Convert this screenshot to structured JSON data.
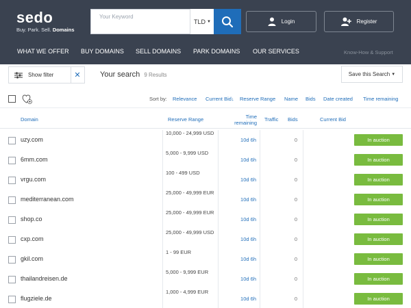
{
  "brand": {
    "name": "sedo",
    "tagline": "Buy. Park. Sell.",
    "tagline_strong": "Domains"
  },
  "search": {
    "placeholder": "Your Keyword",
    "tld_label": "TLD"
  },
  "header_buttons": {
    "login": "Login",
    "register": "Register"
  },
  "nav": {
    "items": [
      "WHAT WE OFFER",
      "BUY DOMAINS",
      "SELL DOMAINS",
      "PARK DOMAINS",
      "OUR SERVICES"
    ],
    "secondary": "Know-How & Support"
  },
  "toolbar": {
    "show_filter": "Show filter",
    "your_search": "Your search",
    "results": "9 Results",
    "save_search": "Save this Search"
  },
  "sort": {
    "label": "Sort by:",
    "options": [
      "Relevance",
      "Current Bid↓",
      "Reserve Range",
      "Name",
      "Bids",
      "Date created",
      "Time remaining"
    ]
  },
  "table": {
    "headers": {
      "domain": "Domain",
      "reserve_range": "Reserve Range",
      "time_remaining_1": "Time",
      "time_remaining_2": "remaining",
      "traffic": "Traffic",
      "bids": "Bids",
      "current_bid": "Current Bid"
    },
    "rows": [
      {
        "domain": "uzy.com",
        "range": "10,000 - 24,999 USD",
        "time": "10d 6h",
        "bids": "0",
        "status": "In auction"
      },
      {
        "domain": "6mm.com",
        "range": "5,000 - 9,999 USD",
        "time": "10d 6h",
        "bids": "0",
        "status": "In auction"
      },
      {
        "domain": "vrgu.com",
        "range": "100 - 499 USD",
        "time": "10d 6h",
        "bids": "0",
        "status": "In auction"
      },
      {
        "domain": "mediterranean.com",
        "range": "25,000 - 49,999 EUR",
        "time": "10d 6h",
        "bids": "0",
        "status": "In auction"
      },
      {
        "domain": "shop.co",
        "range": "25,000 - 49,999 EUR",
        "time": "10d 6h",
        "bids": "0",
        "status": "In auction"
      },
      {
        "domain": "cxp.com",
        "range": "25,000 - 49,999 USD",
        "time": "10d 6h",
        "bids": "0",
        "status": "In auction"
      },
      {
        "domain": "gkil.com",
        "range": "1 - 99 EUR",
        "time": "10d 6h",
        "bids": "0",
        "status": "In auction"
      },
      {
        "domain": "thailandreisen.de",
        "range": "5,000 - 9,999 EUR",
        "time": "10d 6h",
        "bids": "0",
        "status": "In auction"
      },
      {
        "domain": "flugziele.de",
        "range": "1,000 - 4,999 EUR",
        "time": "10d 6h",
        "bids": "0",
        "status": "In auction"
      }
    ]
  },
  "colors": {
    "header_bg": "#3a4250",
    "accent_blue": "#1f6db9",
    "status_green": "#79bb3f"
  }
}
